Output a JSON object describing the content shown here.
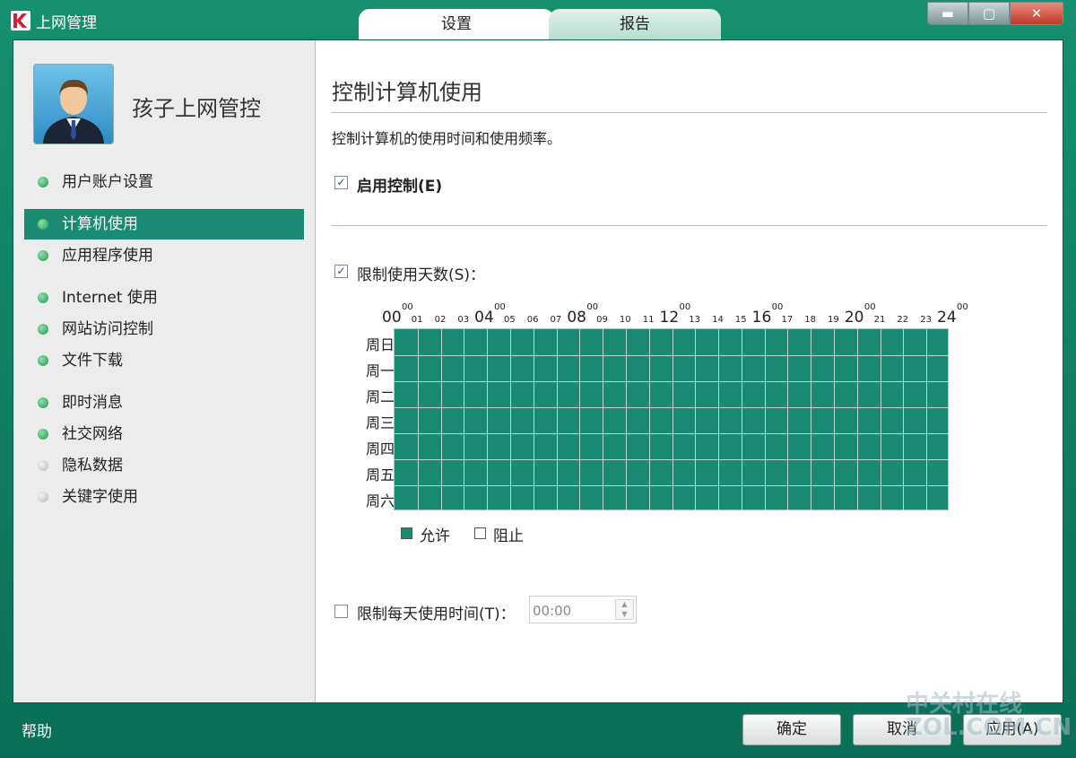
{
  "window": {
    "title": "上网管理",
    "controls": {
      "minimize": "▬",
      "maximize": "▢",
      "close": "✕"
    }
  },
  "tabs": [
    {
      "label": "设置",
      "active": true
    },
    {
      "label": "报告",
      "active": false
    }
  ],
  "sidebar": {
    "profile_name": "孩子上网管控",
    "items": [
      {
        "label": "用户账户设置",
        "status": "green",
        "active": false
      },
      {
        "label": "计算机使用",
        "status": "green",
        "active": true
      },
      {
        "label": "应用程序使用",
        "status": "green",
        "active": false
      },
      {
        "label": "Internet 使用",
        "status": "green",
        "active": false
      },
      {
        "label": "网站访问控制",
        "status": "green",
        "active": false
      },
      {
        "label": "文件下载",
        "status": "green",
        "active": false
      },
      {
        "label": "即时消息",
        "status": "green",
        "active": false
      },
      {
        "label": "社交网络",
        "status": "green",
        "active": false
      },
      {
        "label": "隐私数据",
        "status": "gray",
        "active": false
      },
      {
        "label": "关键字使用",
        "status": "gray",
        "active": false
      }
    ]
  },
  "main": {
    "title": "控制计算机使用",
    "description": "控制计算机的使用时间和使用频率。",
    "enable_control": {
      "label": "启用控制(E)",
      "checked": true
    },
    "limit_days": {
      "label": "限制使用天数(S)：",
      "checked": true
    },
    "schedule": {
      "hour_labels_major": [
        "00",
        "04",
        "08",
        "12",
        "16",
        "20",
        "24"
      ],
      "hour_label_superscript": "00",
      "hour_labels_minor": [
        "01",
        "02",
        "03",
        "05",
        "06",
        "07",
        "09",
        "10",
        "11",
        "13",
        "14",
        "15",
        "17",
        "18",
        "19",
        "21",
        "22",
        "23"
      ],
      "days": [
        "周日",
        "周一",
        "周二",
        "周三",
        "周四",
        "周五",
        "周六"
      ],
      "allowed_color": "#1b8a73",
      "all_allowed": true
    },
    "legend": {
      "allow": "允许",
      "block": "阻止"
    },
    "limit_daily": {
      "label": "限制每天使用时间(T)：",
      "checked": false,
      "value": "00:00"
    }
  },
  "footer": {
    "help": "帮助",
    "ok": "确定",
    "cancel": "取消",
    "apply": "应用(A)"
  },
  "watermark": {
    "line1": "中关村在线",
    "line2": "ZOL.COM.CN"
  }
}
